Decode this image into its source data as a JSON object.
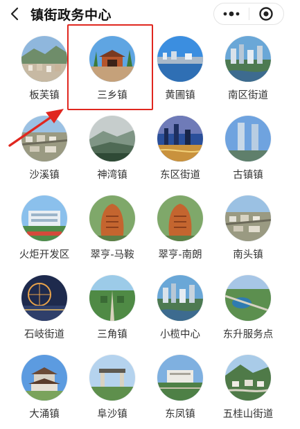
{
  "header": {
    "title": "镇街政务中心",
    "back_icon": "chevron-left-icon",
    "menu_icon": "more-dots-icon",
    "close_icon": "target-icon"
  },
  "items": [
    {
      "label": "板芙镇",
      "theme": "valley"
    },
    {
      "label": "三乡镇",
      "theme": "gate"
    },
    {
      "label": "黄圃镇",
      "theme": "lake"
    },
    {
      "label": "南区街道",
      "theme": "city"
    },
    {
      "label": "沙溪镇",
      "theme": "aerial"
    },
    {
      "label": "神湾镇",
      "theme": "misty"
    },
    {
      "label": "东区街道",
      "theme": "dusk"
    },
    {
      "label": "古镇镇",
      "theme": "towers"
    },
    {
      "label": "火炬开发区",
      "theme": "building"
    },
    {
      "label": "翠亨-马鞍",
      "theme": "stone"
    },
    {
      "label": "翠亨-南朗",
      "theme": "stone"
    },
    {
      "label": "南头镇",
      "theme": "aerial"
    },
    {
      "label": "石岐街道",
      "theme": "night"
    },
    {
      "label": "三角镇",
      "theme": "garden"
    },
    {
      "label": "小榄中心",
      "theme": "city"
    },
    {
      "label": "东升服务点",
      "theme": "park"
    },
    {
      "label": "大涌镇",
      "theme": "pavilion"
    },
    {
      "label": "阜沙镇",
      "theme": "arch"
    },
    {
      "label": "东凤镇",
      "theme": "hall"
    },
    {
      "label": "五桂山街道",
      "theme": "hills"
    }
  ],
  "annotation": {
    "color": "#e0271f",
    "highlighted": "三乡镇"
  }
}
